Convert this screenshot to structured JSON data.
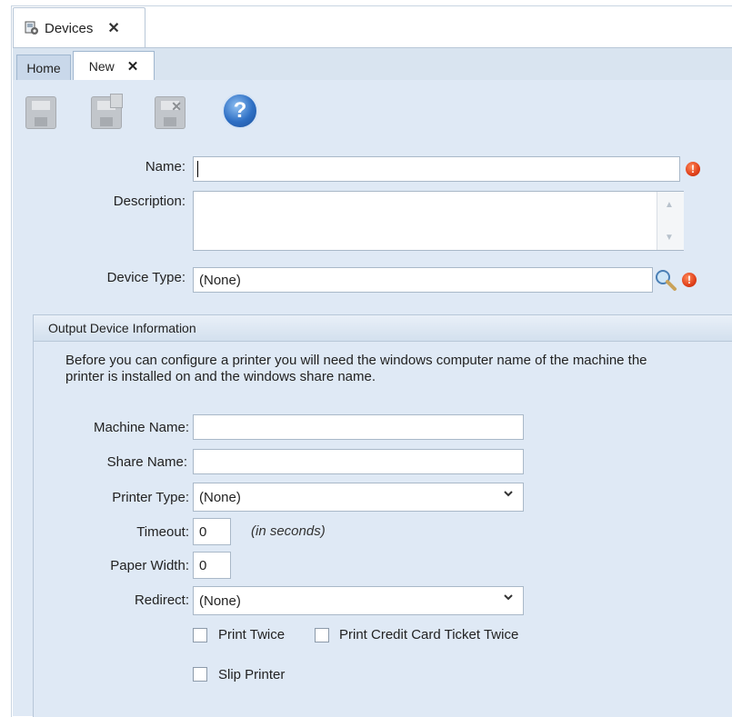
{
  "window_tab": {
    "title": "Devices",
    "close": "✕"
  },
  "tabs": [
    {
      "label": "Home"
    },
    {
      "label": "New",
      "close": "✕"
    }
  ],
  "toolbar": {
    "save_icon": "save-disk-icon",
    "save_new_icon": "save-new-disk-icon",
    "delete_icon": "delete-disk-icon",
    "help_label": "?"
  },
  "form": {
    "name_label": "Name:",
    "name_value": "",
    "description_label": "Description:",
    "description_value": "",
    "device_type_label": "Device Type:",
    "device_type_value": "(None)",
    "error_glyph": "!"
  },
  "output_group": {
    "title": "Output Device Information",
    "info": "Before you can configure a printer you will need the windows computer name of the machine the printer is installed on and the windows share name.",
    "machine_name_label": "Machine Name:",
    "machine_name_value": "",
    "share_name_label": "Share Name:",
    "share_name_value": "",
    "printer_type_label": "Printer Type:",
    "printer_type_value": "(None)",
    "timeout_label": "Timeout:",
    "timeout_value": "0",
    "timeout_unit": "(in seconds)",
    "paper_width_label": "Paper Width:",
    "paper_width_value": "0",
    "redirect_label": "Redirect:",
    "redirect_value": "(None)",
    "print_twice_label": "Print Twice",
    "print_cc_twice_label": "Print Credit Card Ticket Twice",
    "slip_printer_label": "Slip Printer"
  },
  "colors": {
    "panel_bg": "#dfe9f5",
    "tab_strip": "#d9e4f0",
    "accent_blue": "#2e6fc4",
    "error_red": "#e0401a"
  }
}
